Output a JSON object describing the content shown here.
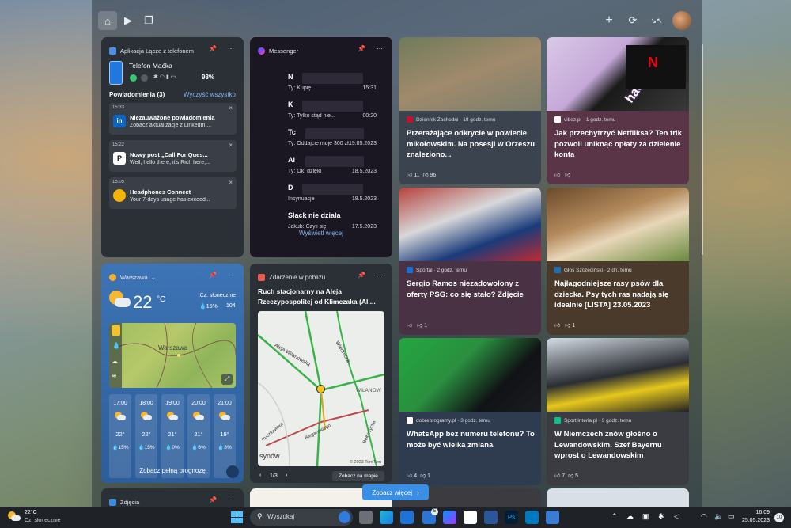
{
  "toolbar": {
    "home_icon": "home-icon",
    "video_icon": "video-icon",
    "apps_icon": "widgets-icon",
    "add_icon": "+",
    "refresh_icon": "⟳",
    "collapse_icon": "↘↖"
  },
  "phone_widget": {
    "title": "Aplikacja Łącze z telefonem",
    "device": "Telefon Maćka",
    "battery": "98%",
    "notif_header": "Powiadomienia (3)",
    "clear_all": "Wyczyść wszystko",
    "notifications": [
      {
        "time": "15:33",
        "title": "Niezauważone powiadomienia",
        "text": "Zobacz aktualizacje z LinkedIn,...",
        "app_color": "#0a66c2",
        "app_letter": "in"
      },
      {
        "time": "15:22",
        "title": "Nowy post „Call For Ques...",
        "text": "Well, hello there, it's Rich here,...",
        "app_color": "#ffffff",
        "app_letter": "P"
      },
      {
        "time": "15:05",
        "title": "Headphones Connect",
        "text": "Your 7-days usage has exceed...",
        "app_color": "#f4b400",
        "app_letter": "🎧"
      }
    ]
  },
  "messenger": {
    "title": "Messenger",
    "more": "Wyświetl więcej",
    "chats": [
      {
        "name": "N",
        "preview": "Ty: Kupię",
        "time": "15:31"
      },
      {
        "name": "K",
        "preview": "Ty: Tylko stąd nie...",
        "time": "00:20"
      },
      {
        "name": "Tc",
        "preview": "Ty: Oddajcie moje 300 zł...",
        "time": "19.05.2023"
      },
      {
        "name": "Al",
        "preview": "Ty: Ok, dzięki",
        "time": "18.5.2023"
      },
      {
        "name": "D",
        "preview": "Insynuacje",
        "time": "18.5.2023"
      },
      {
        "name": "Slack nie działa",
        "preview": "Jakub: Czyli się",
        "time": "17.5.2023"
      }
    ]
  },
  "weather": {
    "city": "Warszawa",
    "temp": "22",
    "unit": "°C",
    "condition": "Cz. słonecznie",
    "precip": "💧15%",
    "wind": "104",
    "map_label": "Warszawa",
    "forecast_link": "Zobacz pełną prognozę",
    "forecast": [
      {
        "hour": "17:00",
        "temp": "22°",
        "precip": "15%"
      },
      {
        "hour": "18:00",
        "temp": "22°",
        "precip": "15%"
      },
      {
        "hour": "19:00",
        "temp": "21°",
        "precip": "0%"
      },
      {
        "hour": "20:00",
        "temp": "21°",
        "precip": "6%"
      },
      {
        "hour": "21:00",
        "temp": "19°",
        "precip": "8%"
      }
    ]
  },
  "traffic": {
    "title": "Zdarzenie w pobliżu",
    "headline": "Ruch stacjonarny na Aleja Rzeczypospolitej od Klimczaka (Al....",
    "pager": "1/3",
    "map_button": "Zobacz na mapie",
    "map_labels": [
      "Aleja Wilanowska",
      "Wiertnicza",
      "WILANÓW",
      "Bełbirzycka",
      "synów",
      "Ruczlowicka",
      "Biegańskiego"
    ],
    "copyright": "© 2023 TomTom"
  },
  "news": [
    {
      "source": "Dziennik Zachodni · 18 godz. temu",
      "headline": "Przerażające odkrycie w powiecie mikołowskim. Na posesji w Orzeszu znaleziono...",
      "likes": "11",
      "dislikes": "96",
      "bg": "#3b434f",
      "src_color": "#c8102e"
    },
    {
      "source": "vibez.pl · 1 godz. temu",
      "headline": "Jak przechytrzyć Netfliksa? Ten trik pozwoli uniknąć opłaty za dzielenie konta",
      "likes": "",
      "dislikes": "",
      "bg": "#5a3548",
      "src_color": "#ffffff",
      "img_text": "hackerman"
    },
    {
      "source": "Sportal · 2 godz. temu",
      "headline": "Sergio Ramos niezadowolony z oferty PSG: co się stało? Zdjęcie",
      "likes": "",
      "dislikes": "1",
      "bg": "#4a3245",
      "src_color": "#1c6fd1"
    },
    {
      "source": "Głos Szczeciński · 2 dn. temu",
      "headline": "Najłagodniejsze rasy psów dla dziecka. Psy tych ras nadają się idealnie [LISTA] 23.05.2023",
      "likes": "",
      "dislikes": "1",
      "bg": "#4a3a2c",
      "src_color": "#1f6fb5"
    },
    {
      "source": "dobreprogramy.pl · 3 godz. temu",
      "headline": "WhatsApp bez numeru telefonu? To może być wielka zmiana",
      "likes": "4",
      "dislikes": "1",
      "bg": "#2f3b4f",
      "src_color": "#ffffff"
    },
    {
      "source": "Sport.interia.pl · 3 godz. temu",
      "headline": "W Niemczech znów głośno o Lewandowskim. Szef Bayernu wprost o Lewandowskim",
      "likes": "7",
      "dislikes": "5",
      "bg": "#3a3c42",
      "src_color": "#00c58e"
    }
  ],
  "bottom": {
    "gallery_title": "Zdjęcia",
    "more_button": "Zobacz więcej"
  },
  "taskbar": {
    "weather_temp": "22°C",
    "weather_text": "Cz. słonecznie",
    "search": "Wyszukaj",
    "time": "16:09",
    "date": "25.05.2023",
    "notif_count": "10",
    "mail_badge": "5"
  }
}
